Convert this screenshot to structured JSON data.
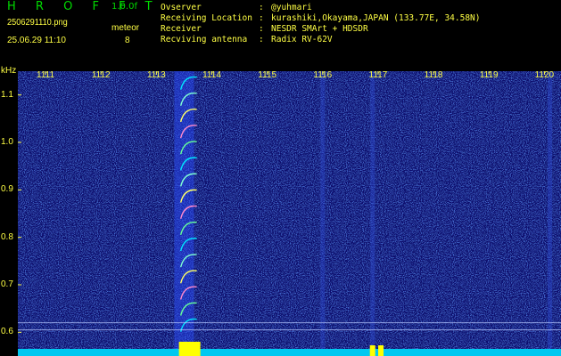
{
  "header": {
    "app_title": "H R O F F T",
    "app_version": "1.0.0f",
    "file_name": "2506291110.png",
    "date_time": "25.06.29 11:10",
    "meteor_label": "meteor",
    "meteor_count": "8"
  },
  "station_info": [
    {
      "label": "Ovserver",
      "sep": ":",
      "value": "@yuhmari"
    },
    {
      "label": "Receiving Location",
      "sep": ":",
      "value": "kurashiki,Okayama,JAPAN (133.77E, 34.58N)"
    },
    {
      "label": "Receiver",
      "sep": ":",
      "value": "NESDR SMArt + HDSDR"
    },
    {
      "label": "Recviving antenna",
      "sep": ":",
      "value": "Radix RV-62V"
    }
  ],
  "colors": {
    "background": "#000000",
    "noise_base": "#0a0a6e",
    "label_yellow": "#ffff44",
    "title_green": "#00d800",
    "signal_cyan": "#00e5ff",
    "signal_yellow": "#ffff00"
  },
  "chart_data": {
    "type": "heatmap",
    "ylabel": "kHz",
    "y_ticks": [
      "1.1",
      "1.0",
      "0.9",
      "0.8",
      "0.7",
      "0.6"
    ],
    "x_ticks": [
      "1111",
      "1112",
      "1113",
      "1114",
      "1115",
      "1116",
      "1117",
      "1118",
      "1119",
      "1120"
    ],
    "ylim": [
      0.55,
      1.15
    ],
    "xlim": [
      1110.5,
      1120.3
    ],
    "meteor_echo_column_minute": 1113.6,
    "meteor_arcs_count": 16,
    "strong_vertical_columns_minute": [
      1113.5,
      1116.0,
      1116.9,
      1120.1
    ],
    "meteor_count": 8
  }
}
